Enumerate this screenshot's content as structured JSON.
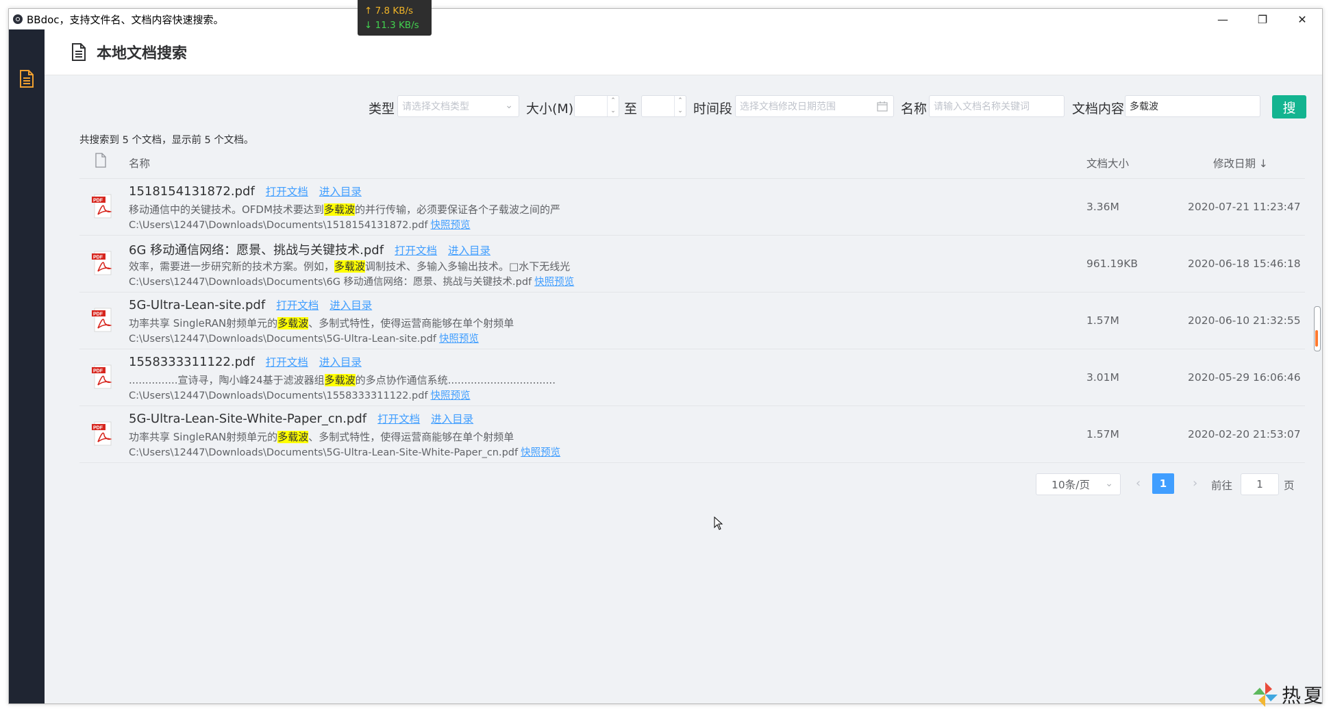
{
  "window": {
    "title": "BBdoc，支持文件名、文档内容快速搜索。",
    "controls": {
      "minimize": "—",
      "restore": "❐",
      "close": "✕"
    }
  },
  "netspeed": {
    "up": "↑ 7.8 KB/s",
    "down": "↓ 11.3 KB/s"
  },
  "header": {
    "title": "本地文档搜索"
  },
  "filters": {
    "type_label": "类型",
    "type_placeholder": "请选择文档类型",
    "size_label": "大小(M)",
    "size_to_label": "至",
    "time_label": "时间段",
    "time_placeholder": "选择文档修改日期范围",
    "name_label": "名称",
    "name_placeholder": "请输入文档名称关键词",
    "content_label": "文档内容",
    "content_value": "多载波",
    "search_button": "搜"
  },
  "summary": "共搜索到 5 个文档，显示前 5 个文档。",
  "table": {
    "columns": {
      "name": "名称",
      "size": "文档大小",
      "date": "修改日期 ↓"
    },
    "open_label": "打开文档",
    "dir_label": "进入目录",
    "preview_label": "快照预览",
    "rows": [
      {
        "name": "1518154131872.pdf",
        "excerpt_pre": "移动通信中的关键技术。OFDM技术要达到",
        "excerpt_hl": "多载波",
        "excerpt_post": "的并行传输，必须要保证各个子载波之间的严",
        "path": "C:\\Users\\12447\\Downloads\\Documents\\1518154131872.pdf",
        "size": "3.36M",
        "date": "2020-07-21 11:23:47"
      },
      {
        "name": "6G 移动通信网络：愿景、挑战与关键技术.pdf",
        "excerpt_pre": "效率，需要进一步研究新的技术方案。例如，",
        "excerpt_hl": "多载波",
        "excerpt_post": "调制技术、多输入多输出技术。□水下无线光",
        "path": "C:\\Users\\12447\\Downloads\\Documents\\6G 移动通信网络：愿景、挑战与关键技术.pdf",
        "size": "961.19KB",
        "date": "2020-06-18 15:46:18"
      },
      {
        "name": "5G-Ultra-Lean-site.pdf",
        "excerpt_pre": "功率共享 SingleRAN射频单元的",
        "excerpt_hl": "多载波",
        "excerpt_post": "、多制式特性，使得运营商能够在单个射频单",
        "path": "C:\\Users\\12447\\Downloads\\Documents\\5G-Ultra-Lean-site.pdf",
        "size": "1.57M",
        "date": "2020-06-10 21:32:55"
      },
      {
        "name": "1558333311122.pdf",
        "excerpt_pre": "...............宣诗寻，陶小峰24基于滤波器组",
        "excerpt_hl": "多载波",
        "excerpt_post": "的多点协作通信系统.................................",
        "path": "C:\\Users\\12447\\Downloads\\Documents\\1558333311122.pdf",
        "size": "3.01M",
        "date": "2020-05-29 16:06:46"
      },
      {
        "name": "5G-Ultra-Lean-Site-White-Paper_cn.pdf",
        "excerpt_pre": "功率共享 SingleRAN射频单元的",
        "excerpt_hl": "多载波",
        "excerpt_post": "、多制式特性，使得运营商能够在单个射频单",
        "path": "C:\\Users\\12447\\Downloads\\Documents\\5G-Ultra-Lean-Site-White-Paper_cn.pdf",
        "size": "1.57M",
        "date": "2020-02-20 21:53:07"
      }
    ]
  },
  "pagination": {
    "page_size": "10条/页",
    "current_page": "1",
    "goto_label": "前往",
    "goto_value": "1",
    "unit_label": "页",
    "prev": "‹",
    "next": "›"
  },
  "watermark": {
    "text": "热夏"
  },
  "colors": {
    "sidebar": "#1f2532",
    "accent_button": "#13b490",
    "link": "#409eff",
    "highlight": "#ffff00",
    "icon_orange": "#f0a030"
  }
}
